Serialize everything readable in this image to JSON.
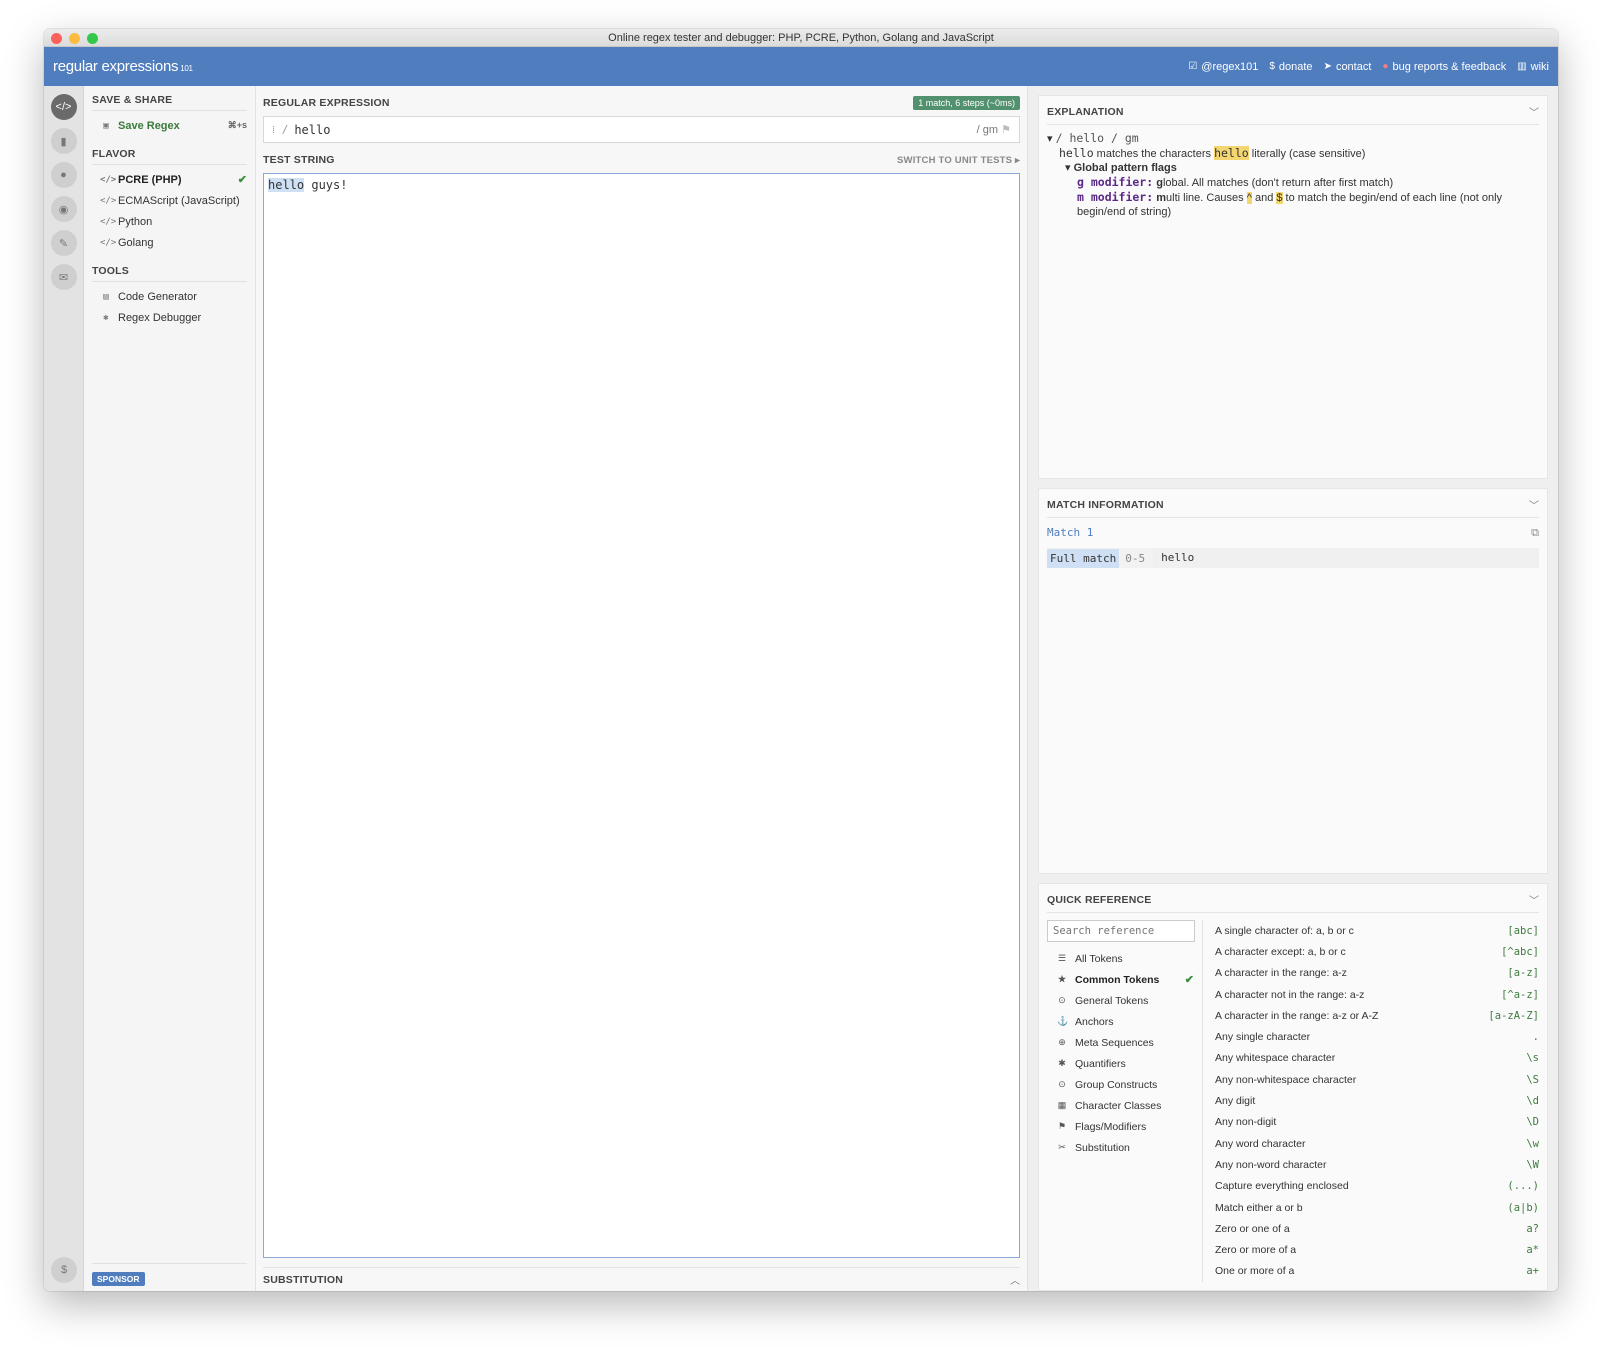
{
  "window": {
    "title": "Online regex tester and debugger: PHP, PCRE, Python, Golang and JavaScript"
  },
  "header": {
    "logo_part1": "regular",
    "logo_part2": " expressions",
    "logo_part3": "101",
    "links": [
      {
        "icon": "twitter-icon",
        "label": "@regex101"
      },
      {
        "icon": "dollar-icon",
        "label": "donate"
      },
      {
        "icon": "send-icon",
        "label": "contact"
      },
      {
        "icon": "bug-icon",
        "label": "bug reports & feedback"
      },
      {
        "icon": "book-icon",
        "label": "wiki"
      }
    ]
  },
  "sidebar": {
    "save_title": "SAVE & SHARE",
    "save_label": "Save Regex",
    "save_shortcut": "⌘+s",
    "flavor_title": "FLAVOR",
    "flavors": [
      "PCRE (PHP)",
      "ECMAScript (JavaScript)",
      "Python",
      "Golang"
    ],
    "tools_title": "TOOLS",
    "tools": [
      "Code Generator",
      "Regex Debugger"
    ],
    "sponsor": "SPONSOR"
  },
  "regex": {
    "title": "REGULAR EXPRESSION",
    "match_info": "1 match, 6 steps (~0ms)",
    "delimiter": "/",
    "pattern": "hello",
    "flags": "/ gm"
  },
  "test": {
    "title": "TEST STRING",
    "switch_label": "SWITCH TO UNIT TESTS",
    "match_text": "hello",
    "rest_text": " guys!"
  },
  "substitution": {
    "title": "SUBSTITUTION"
  },
  "explanation": {
    "title": "EXPLANATION",
    "root": "/ hello / gm",
    "token": "hello",
    "desc_pre": " matches the characters ",
    "desc_hl": "hello",
    "desc_post": " literally (case sensitive)",
    "flags_title": "Global pattern flags",
    "g_mod": "g modifier:",
    "g_desc_bold": "g",
    "g_desc": "lobal. All matches (don't return after first match)",
    "m_mod": "m modifier:",
    "m_desc_bold": "m",
    "m_desc1": "ulti line. Causes ",
    "caret": "^",
    "and": " and ",
    "dollar": "$",
    "m_desc2": " to match the begin/end of each line (not only begin/end of string)"
  },
  "match_information": {
    "title": "MATCH INFORMATION",
    "match_label": "Match 1",
    "full_match": "Full match",
    "range": "0-5",
    "value": "hello"
  },
  "quick_reference": {
    "title": "QUICK REFERENCE",
    "search_placeholder": "Search reference",
    "categories": [
      {
        "icon": "database-icon",
        "label": "All Tokens"
      },
      {
        "icon": "star-icon",
        "label": "Common Tokens"
      },
      {
        "icon": "dot-circle-icon",
        "label": "General Tokens"
      },
      {
        "icon": "anchor-icon",
        "label": "Anchors"
      },
      {
        "icon": "globe-icon",
        "label": "Meta Sequences"
      },
      {
        "icon": "asterisk-icon",
        "label": "Quantifiers"
      },
      {
        "icon": "dot-circle-icon",
        "label": "Group Constructs"
      },
      {
        "icon": "grid-icon",
        "label": "Character Classes"
      },
      {
        "icon": "flag-icon",
        "label": "Flags/Modifiers"
      },
      {
        "icon": "scissors-icon",
        "label": "Substitution"
      }
    ],
    "tokens": [
      {
        "desc": "A single character of: a, b or c",
        "tok": "[abc]"
      },
      {
        "desc": "A character except: a, b or c",
        "tok": "[^abc]"
      },
      {
        "desc": "A character in the range: a-z",
        "tok": "[a-z]"
      },
      {
        "desc": "A character not in the range: a-z",
        "tok": "[^a-z]"
      },
      {
        "desc": "A character in the range: a-z or A-Z",
        "tok": "[a-zA-Z]"
      },
      {
        "desc": "Any single character",
        "tok": "."
      },
      {
        "desc": "Any whitespace character",
        "tok": "\\s"
      },
      {
        "desc": "Any non-whitespace character",
        "tok": "\\S"
      },
      {
        "desc": "Any digit",
        "tok": "\\d"
      },
      {
        "desc": "Any non-digit",
        "tok": "\\D"
      },
      {
        "desc": "Any word character",
        "tok": "\\w"
      },
      {
        "desc": "Any non-word character",
        "tok": "\\W"
      },
      {
        "desc": "Capture everything enclosed",
        "tok": "(...)"
      },
      {
        "desc": "Match either a or b",
        "tok": "(a|b)"
      },
      {
        "desc": "Zero or one of a",
        "tok": "a?"
      },
      {
        "desc": "Zero or more of a",
        "tok": "a*"
      },
      {
        "desc": "One or more of a",
        "tok": "a+"
      }
    ]
  },
  "colors": {
    "brand": "#4f7dbe",
    "match_badge": "#52916d",
    "match_highlight": "#cfe0f4"
  }
}
